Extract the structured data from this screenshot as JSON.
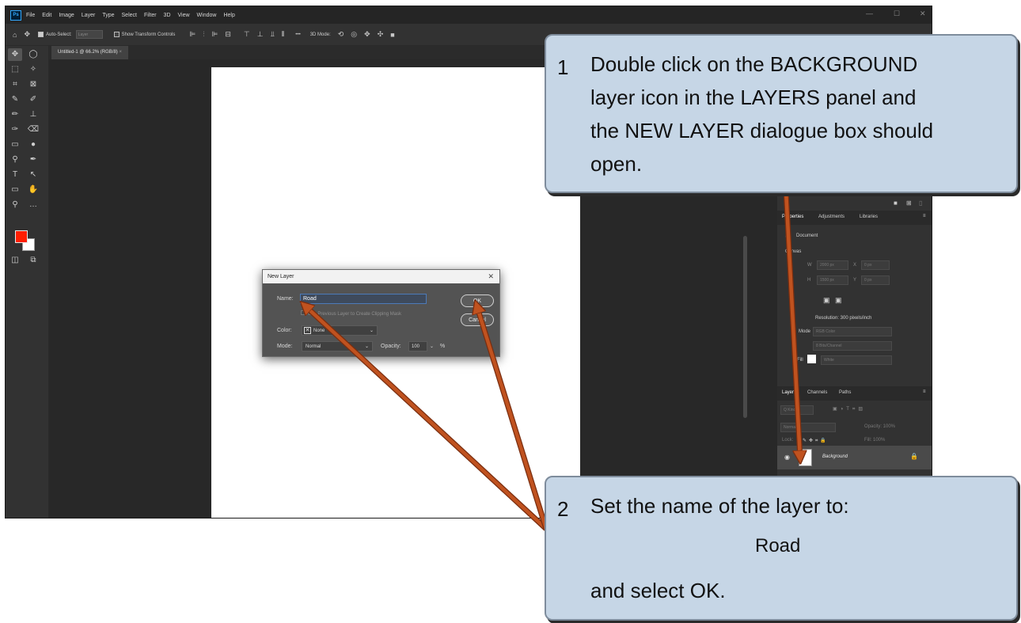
{
  "photoshop": {
    "app_icon": "Ps",
    "menu": [
      "File",
      "Edit",
      "Image",
      "Layer",
      "Type",
      "Select",
      "Filter",
      "3D",
      "View",
      "Window",
      "Help"
    ],
    "window_controls": [
      "—",
      "☐",
      "✕"
    ],
    "options_bar": {
      "auto_select_label": "Auto-Select:",
      "auto_select_value": "Layer",
      "transform_controls_label": "Show Transform Controls",
      "mode_3d_label": "3D Mode:",
      "more_label": "•••"
    },
    "document_tab": "Untitled-1 @ 66.2% (RGB/8)",
    "document_tab_close": "×",
    "panels": {
      "properties_tabs": [
        "Properties",
        "Adjustments",
        "Libraries"
      ],
      "properties_section": "Document",
      "canvas_section": "Canvas",
      "w_label": "W",
      "w_value": "2000 px",
      "h_label": "H",
      "h_value": "1500 px",
      "x_label": "X",
      "x_value": "0 px",
      "y_label": "Y",
      "y_value": "0 px",
      "resolution_label": "Resolution: 300 pixels/inch",
      "mode_label": "Mode",
      "mode_value": "RGB Color",
      "bit_value": "8 Bits/Channel",
      "fill_label": "Fill",
      "fill_value": "White",
      "layers_tabs": [
        "Layers",
        "Channels",
        "Paths"
      ],
      "kind_label": "Q Kind",
      "opacity_label": "Opacity: 100%",
      "blend_value": "Normal",
      "lock_label": "Lock:",
      "fill_pct_label": "Fill: 100%",
      "layer_name": "Background"
    },
    "dialog": {
      "title": "New Layer",
      "close": "✕",
      "name_label": "Name:",
      "name_value": "Road",
      "clipping_check_label": "Use Previous Layer to Create Clipping Mask",
      "color_label": "Color:",
      "color_value": "None",
      "mode_label": "Mode:",
      "mode_value": "Normal",
      "opacity_label": "Opacity:",
      "opacity_value": "100",
      "opacity_unit": "%",
      "ok_label": "OK",
      "cancel_label": "Cancel"
    }
  },
  "callout1": {
    "number": "1",
    "line1": "Double click on the BACKGROUND",
    "line2": "layer icon in the LAYERS panel and",
    "line3": "the NEW LAYER dialogue box should",
    "line4": "open."
  },
  "callout2": {
    "number": "2",
    "line1": "Set the name of the layer to:",
    "road": "Road",
    "line3": "and select OK."
  },
  "colors": {
    "callout_fill": "#c6d6e6",
    "arrow": "#c0521f",
    "foreground_color": "#ff1e00"
  }
}
